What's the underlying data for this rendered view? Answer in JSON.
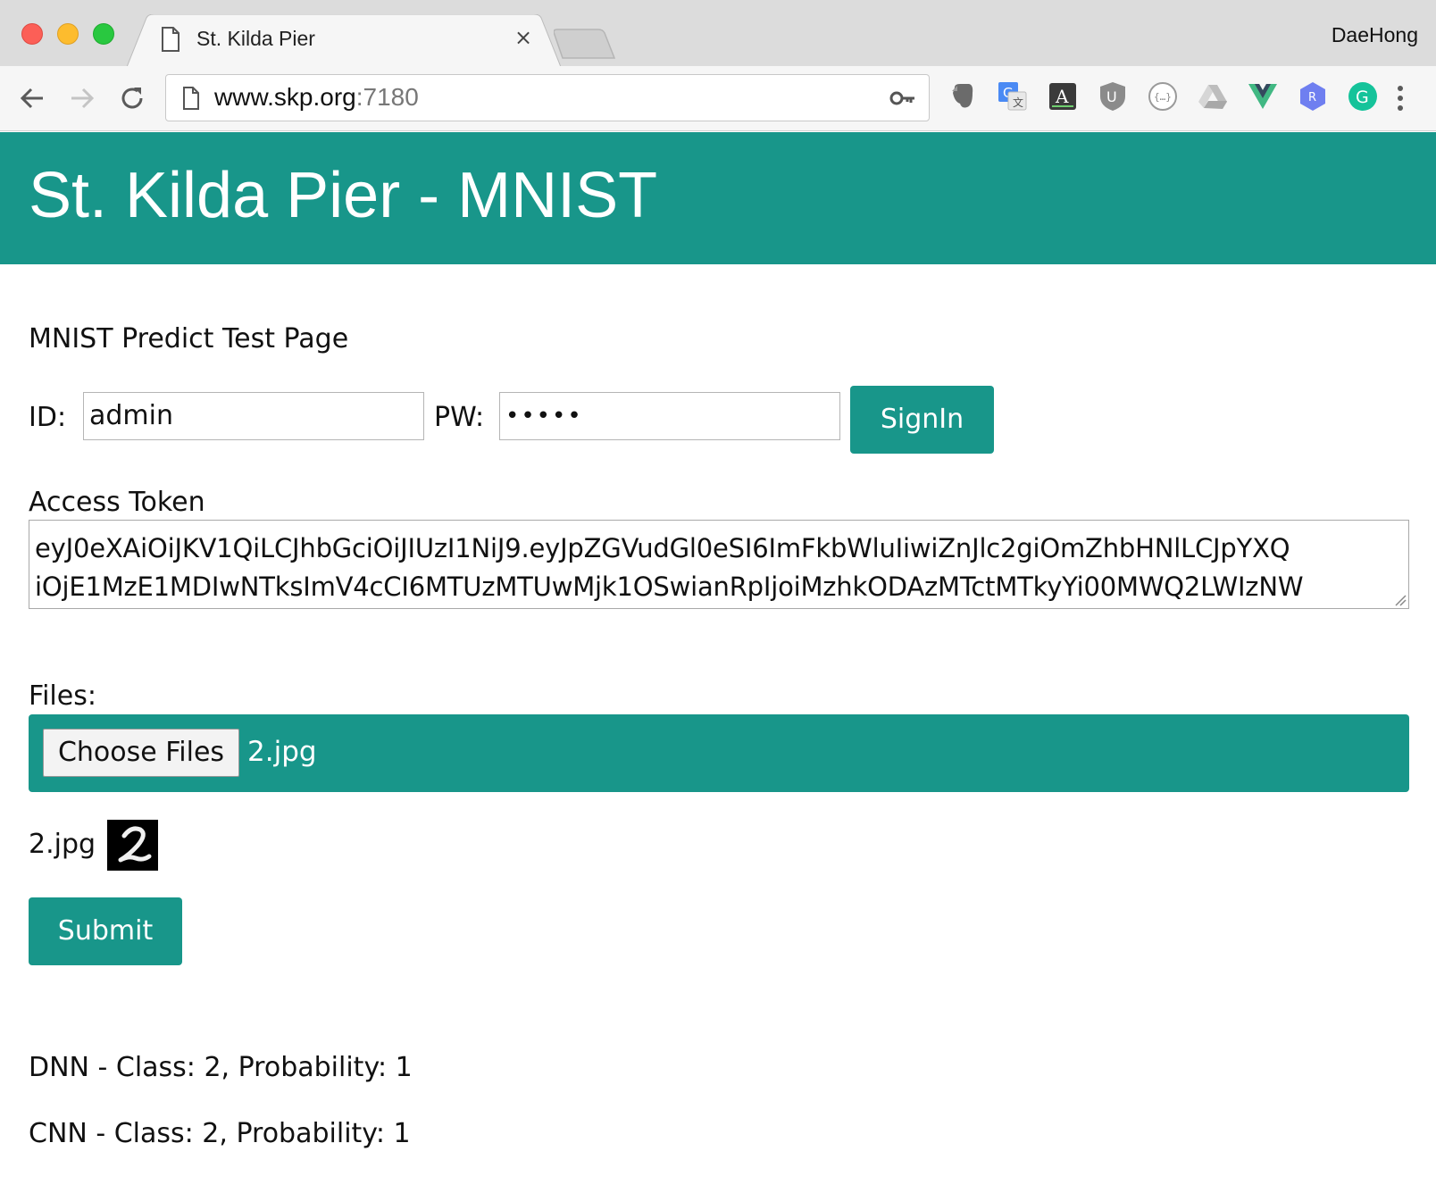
{
  "browser": {
    "tab_title": "St. Kilda Pier",
    "profile_name": "DaeHong",
    "url_host": "www.skp.org",
    "url_port": ":7180",
    "extensions": [
      "evernote-icon",
      "google-translate-icon",
      "a-dictionary-icon",
      "ublock-icon",
      "json-viewer-icon",
      "google-drive-icon",
      "vue-devtools-icon",
      "react-devtools-icon",
      "grammarly-icon"
    ]
  },
  "banner": {
    "title": "St. Kilda Pier - MNIST"
  },
  "page": {
    "heading": "MNIST Predict Test Page"
  },
  "login": {
    "id_label": "ID:",
    "id_value": "admin",
    "pw_label": "PW:",
    "pw_masked": "•••••",
    "signin_label": "SignIn"
  },
  "token": {
    "label": "Access Token",
    "line1": "eyJ0eXAiOiJKV1QiLCJhbGciOiJIUzI1NiJ9.eyJpZGVudGl0eSI6ImFkbWluIiwiZnJlc2giOmZhbHNlLCJpYXQ",
    "line2": "iOjE1MzE1MDIwNTksImV4cCI6MTUzMTUwMjk1OSwianRpIjoiMzhkODAzMTctMTkyYi00MWQ2LWIzNW"
  },
  "files": {
    "label": "Files:",
    "choose_label": "Choose Files",
    "chosen_file": "2.jpg"
  },
  "preview": {
    "file_name": "2.jpg"
  },
  "submit_label": "Submit",
  "results": {
    "dnn": "DNN - Class: 2, Probability: 1",
    "cnn": "CNN - Class: 2, Probability: 1"
  },
  "colors": {
    "accent": "#18968a"
  }
}
